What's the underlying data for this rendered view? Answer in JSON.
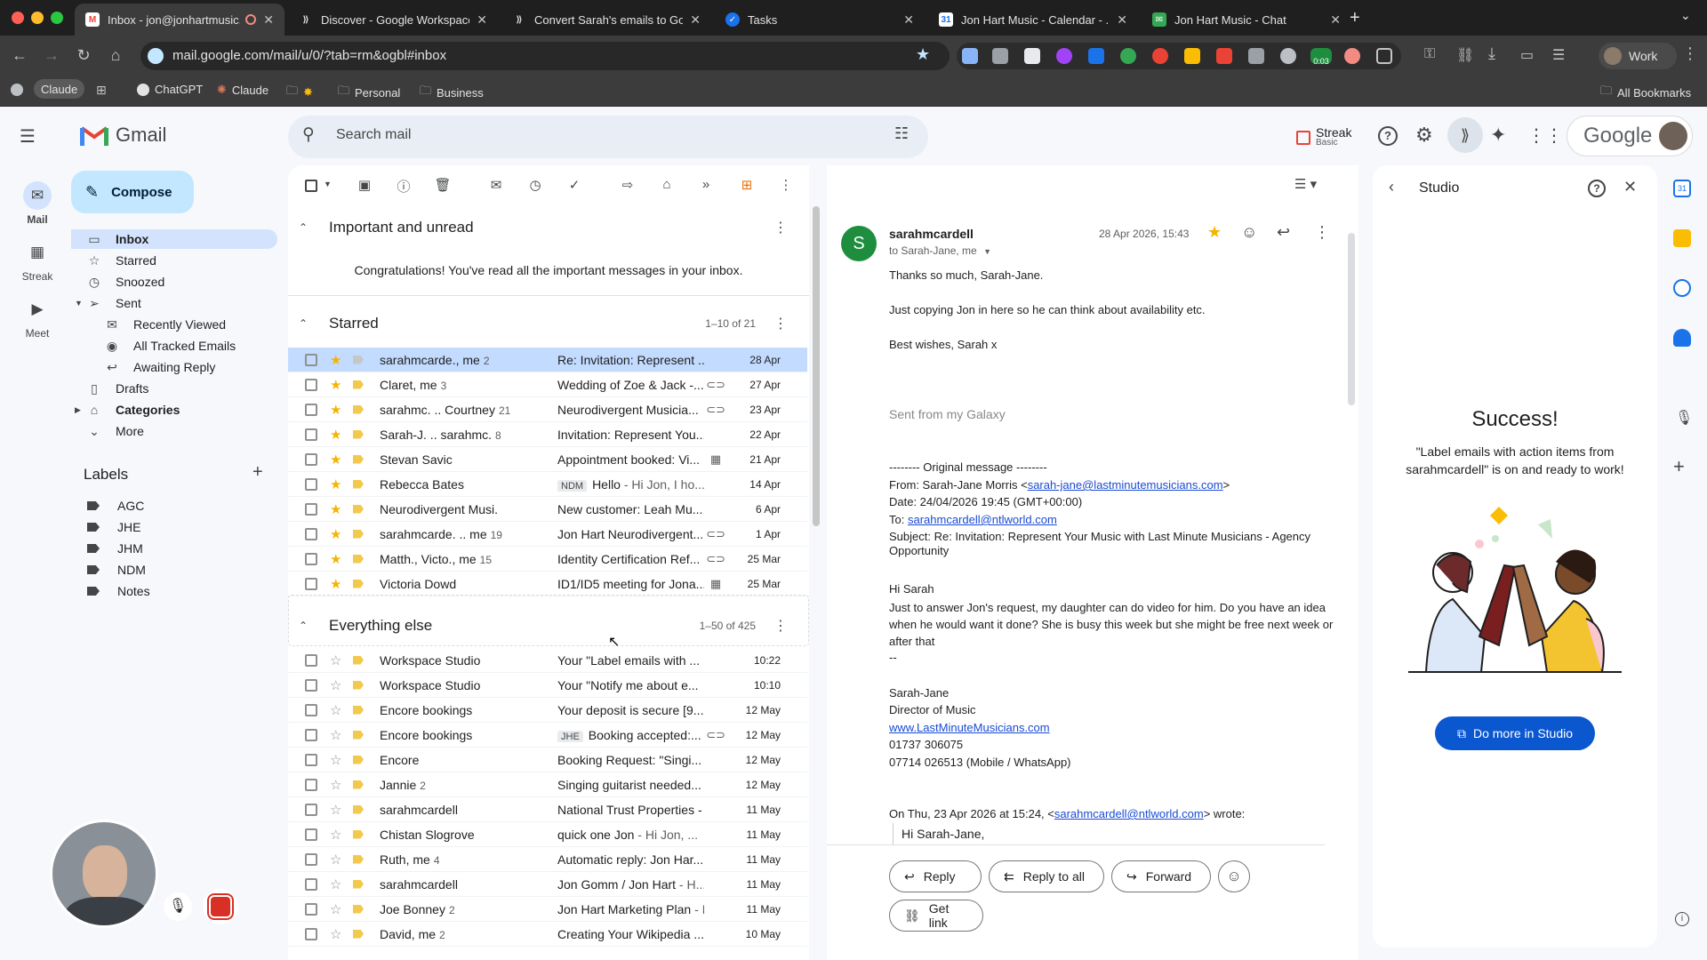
{
  "browser": {
    "tabs": [
      {
        "title": "Inbox - jon@jonhartmusic...",
        "favicon": "gmail-icon",
        "active": true
      },
      {
        "title": "Discover - Google Workspace",
        "favicon": "workspace-icon",
        "active": false
      },
      {
        "title": "Convert Sarah's emails to Go...",
        "favicon": "workspace-icon",
        "active": false
      },
      {
        "title": "Tasks",
        "favicon": "tasks-icon",
        "active": false
      },
      {
        "title": "Jon Hart Music - Calendar - ...",
        "favicon": "calendar-icon",
        "active": false
      },
      {
        "title": "Jon Hart Music - Chat",
        "favicon": "chat-icon",
        "active": false
      }
    ],
    "url": "mail.google.com/mail/u/0/?tab=rm&ogbl#inbox",
    "profile": "Work",
    "timer_badge": "0:03",
    "bookmarks": [
      "Claude",
      "ChatGPT",
      "Claude",
      "Personal",
      "Business"
    ],
    "all_bookmarks": "All Bookmarks"
  },
  "gmail": {
    "logo_text": "Gmail",
    "search_placeholder": "Search mail",
    "streak_label": "Streak",
    "streak_plan": "Basic",
    "google_text": "Google",
    "rail": [
      {
        "label": "Mail"
      },
      {
        "label": "Streak"
      },
      {
        "label": "Meet"
      }
    ],
    "compose_label": "Compose",
    "nav": [
      {
        "label": "Inbox",
        "icon": "inbox-icon"
      },
      {
        "label": "Starred",
        "icon": "star-icon"
      },
      {
        "label": "Snoozed",
        "icon": "clock-icon"
      },
      {
        "label": "Sent",
        "icon": "send-icon"
      },
      {
        "label": "Recently Viewed",
        "icon": "envelope-open-icon"
      },
      {
        "label": "All Tracked Emails",
        "icon": "eye-icon"
      },
      {
        "label": "Awaiting Reply",
        "icon": "reply-icon"
      },
      {
        "label": "Drafts",
        "icon": "draft-icon"
      },
      {
        "label": "Categories",
        "icon": "label-icon"
      },
      {
        "label": "More",
        "icon": "chevron-down-icon"
      }
    ],
    "labels_title": "Labels",
    "labels": [
      "AGC",
      "JHE",
      "JHM",
      "NDM",
      "Notes"
    ]
  },
  "list": {
    "important": {
      "title": "Important and unread",
      "empty_text": "Congratulations! You've read all the important messages in your inbox."
    },
    "starred": {
      "title": "Starred",
      "count": "1–10 of 21",
      "rows": [
        {
          "from": "sarahmcarde., me",
          "cnt": "2",
          "subject": "Re: Invitation: Represent ...",
          "snippet": "",
          "label": "",
          "attach": "",
          "date": "28 Apr",
          "selected": true,
          "starred": true,
          "imp": false
        },
        {
          "from": "Claret, me",
          "cnt": "3",
          "subject": "Wedding of Zoe & Jack -...",
          "snippet": "",
          "label": "",
          "attach": "link",
          "date": "27 Apr",
          "selected": false,
          "starred": true,
          "imp": true
        },
        {
          "from": "sarahmc. .. Courtney",
          "cnt": "21",
          "subject": "Neurodivergent Musicia...",
          "snippet": "",
          "label": "",
          "attach": "link",
          "date": "23 Apr",
          "selected": false,
          "starred": true,
          "imp": true
        },
        {
          "from": "Sarah-J. .. sarahmc.",
          "cnt": "8",
          "subject": "Invitation: Represent You...",
          "snippet": "",
          "label": "",
          "attach": "",
          "date": "22 Apr",
          "selected": false,
          "starred": true,
          "imp": true
        },
        {
          "from": "Stevan Savic",
          "cnt": "",
          "subject": "Appointment booked: Vi...",
          "snippet": "",
          "label": "",
          "attach": "cal",
          "date": "21 Apr",
          "selected": false,
          "starred": true,
          "imp": true
        },
        {
          "from": "Rebecca Bates",
          "cnt": "",
          "subject": "Hello",
          "snippet": " - Hi Jon, I ho...",
          "label": "NDM",
          "attach": "",
          "date": "14 Apr",
          "selected": false,
          "starred": true,
          "imp": true
        },
        {
          "from": "Neurodivergent Musi.",
          "cnt": "",
          "subject": "New customer: Leah Mu...",
          "snippet": "",
          "label": "",
          "attach": "",
          "date": "6 Apr",
          "selected": false,
          "starred": true,
          "imp": true
        },
        {
          "from": "sarahmcarde. .. me",
          "cnt": "19",
          "subject": "Jon Hart Neurodivergent...",
          "snippet": "",
          "label": "",
          "attach": "link",
          "date": "1 Apr",
          "selected": false,
          "starred": true,
          "imp": true
        },
        {
          "from": "Matth., Victo., me",
          "cnt": "15",
          "subject": "Identity Certification Ref...",
          "snippet": "",
          "label": "",
          "attach": "link",
          "date": "25 Mar",
          "selected": false,
          "starred": true,
          "imp": true
        },
        {
          "from": "Victoria Dowd",
          "cnt": "",
          "subject": "ID1/ID5 meeting for Jona...",
          "snippet": "",
          "label": "",
          "attach": "cal",
          "date": "25 Mar",
          "selected": false,
          "starred": true,
          "imp": true
        }
      ]
    },
    "everything": {
      "title": "Everything else",
      "count": "1–50 of 425",
      "rows": [
        {
          "from": "Workspace Studio",
          "cnt": "",
          "subject": "Your \"Label emails with ...",
          "snippet": "",
          "label": "",
          "attach": "",
          "date": "10:22",
          "starred": false
        },
        {
          "from": "Workspace Studio",
          "cnt": "",
          "subject": "Your \"Notify me about e...",
          "snippet": "",
          "label": "",
          "attach": "",
          "date": "10:10",
          "starred": false
        },
        {
          "from": "Encore bookings",
          "cnt": "",
          "subject": "Your deposit is secure [9...",
          "snippet": "",
          "label": "",
          "attach": "",
          "date": "12 May",
          "starred": false
        },
        {
          "from": "Encore bookings",
          "cnt": "",
          "subject": "Booking accepted:...",
          "snippet": "",
          "label": "JHE",
          "attach": "link",
          "date": "12 May",
          "starred": false
        },
        {
          "from": "Encore",
          "cnt": "",
          "subject": "Booking Request: \"Singi...",
          "snippet": "",
          "label": "",
          "attach": "",
          "date": "12 May",
          "starred": false
        },
        {
          "from": "Jannie",
          "cnt": "2",
          "subject": "Singing guitarist needed...",
          "snippet": "",
          "label": "",
          "attach": "",
          "date": "12 May",
          "starred": false
        },
        {
          "from": "sarahmcardell",
          "cnt": "",
          "subject": "National Trust Properties -",
          "snippet": "",
          "label": "",
          "attach": "",
          "date": "11 May",
          "starred": false
        },
        {
          "from": "Chistan Slogrove",
          "cnt": "",
          "subject": "quick one Jon",
          "snippet": " - Hi Jon, ...",
          "label": "",
          "attach": "",
          "date": "11 May",
          "starred": false
        },
        {
          "from": "Ruth, me",
          "cnt": "4",
          "subject": "Automatic reply: Jon Har...",
          "snippet": "",
          "label": "",
          "attach": "",
          "date": "11 May",
          "starred": false
        },
        {
          "from": "sarahmcardell",
          "cnt": "",
          "subject": "Jon Gomm / Jon Hart",
          "snippet": " - H...",
          "label": "",
          "attach": "",
          "date": "11 May",
          "starred": false
        },
        {
          "from": "Joe Bonney",
          "cnt": "2",
          "subject": "Jon Hart Marketing Plan",
          "snippet": " - I",
          "label": "",
          "attach": "",
          "date": "11 May",
          "starred": false
        },
        {
          "from": "David, me",
          "cnt": "2",
          "subject": "Creating Your Wikipedia ...",
          "snippet": "",
          "label": "",
          "attach": "",
          "date": "10 May",
          "starred": false
        }
      ]
    }
  },
  "message": {
    "avatar_letter": "S",
    "sender": "sarahmcardell",
    "date": "28 Apr 2026, 15:43",
    "to": "to Sarah-Jane, me",
    "lines": [
      "Thanks so much, Sarah-Jane.",
      "Just copying Jon in here so he can think about availability etc.",
      "Best wishes, Sarah x"
    ],
    "signature": "Sent from my Galaxy",
    "original_header": "-------- Original message --------",
    "from_prefix": "From: Sarah-Jane Morris <",
    "from_email": "sarah-jane@lastminutemusicians.com",
    "from_suffix": ">",
    "date_line": "Date: 24/04/2026 19:45 (GMT+00:00)",
    "to_prefix": "To: ",
    "to_email": "sarahmcardell@ntlworld.com",
    "subject_line": "Subject: Re: Invitation: Represent Your Music with Last Minute Musicians - Agency Opportunity",
    "greeting": "Hi Sarah",
    "body": "Just to answer Jon's request, my daughter can do video for him. Do you have an idea when he would want it done? She is busy this week but she might be free next week or after that",
    "dashes": "--",
    "sig_name": "Sarah-Jane",
    "sig_title": "Director of Music",
    "sig_site": "www.LastMinuteMusicians.com",
    "sig_phone1": "01737 306075",
    "sig_phone2": "07714 026513 (Mobile / WhatsApp)",
    "quote_prefix": "On Thu, 23 Apr 2026 at 15:24, <",
    "quote_email": "sarahmcardell@ntlworld.com",
    "quote_suffix": "> wrote:",
    "quote_greeting": "Hi Sarah-Jane,",
    "reply_label": "Reply",
    "reply_all_label": "Reply to all",
    "forward_label": "Forward",
    "get_link_label": "Get link"
  },
  "studio": {
    "title": "Studio",
    "success_title": "Success!",
    "success_text": "\"Label emails with action items from sarahmcardell\" is on and ready to work!",
    "cta": "Do more in Studio"
  },
  "colors": {
    "accent": "#0b57d0",
    "selected_row": "#c2dbff",
    "compose_bg": "#c2e7ff",
    "star": "#f4b400",
    "avatar_green": "#1e8e3e"
  }
}
